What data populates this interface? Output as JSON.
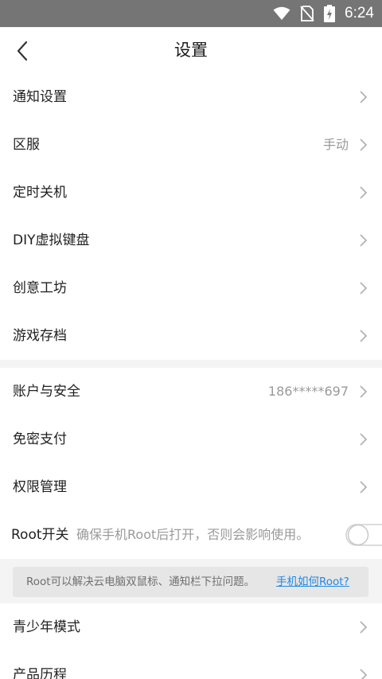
{
  "status_bar": {
    "time": "6:24"
  },
  "header": {
    "title": "设置"
  },
  "settings_group_1": [
    {
      "label": "通知设置",
      "value": ""
    },
    {
      "label": "区服",
      "value": "手动"
    },
    {
      "label": "定时关机",
      "value": ""
    },
    {
      "label": "DIY虚拟键盘",
      "value": ""
    },
    {
      "label": "创意工坊",
      "value": ""
    },
    {
      "label": "游戏存档",
      "value": ""
    }
  ],
  "settings_group_2": [
    {
      "label": "账户与安全",
      "value": "186*****697"
    },
    {
      "label": "免密支付",
      "value": ""
    },
    {
      "label": "权限管理",
      "value": ""
    }
  ],
  "root_switch": {
    "label": "Root开关",
    "hint": "确保手机Root后打开，否则会影响使用。",
    "enabled": false
  },
  "root_notice": {
    "text": "Root可以解决云电脑双鼠标、通知栏下拉问题。",
    "link": "手机如何Root?"
  },
  "settings_group_3": [
    {
      "label": "青少年模式",
      "value": ""
    },
    {
      "label": "产品历程",
      "value": ""
    }
  ]
}
